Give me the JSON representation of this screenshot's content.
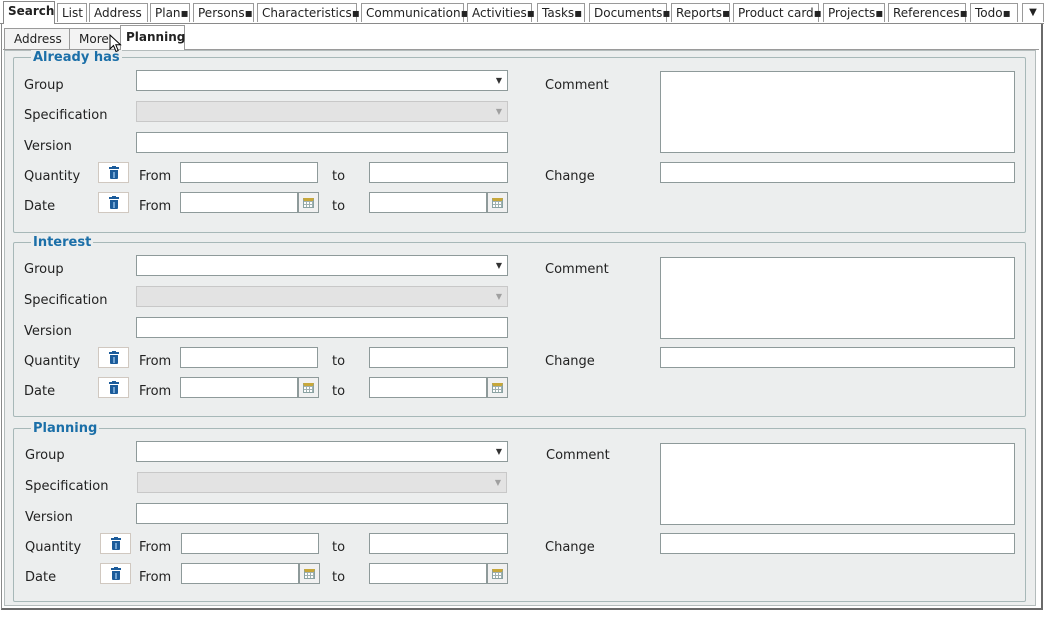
{
  "top_tabs": [
    {
      "label": "Search",
      "active": true
    },
    {
      "label": "List"
    },
    {
      "label": "Address"
    },
    {
      "label": "Plan▪"
    },
    {
      "label": "Persons▪"
    },
    {
      "label": "Characteristics▪"
    },
    {
      "label": "Communication▪"
    },
    {
      "label": "Activities▪"
    },
    {
      "label": "Tasks▪"
    },
    {
      "label": "Documents▪"
    },
    {
      "label": "Reports▪"
    },
    {
      "label": "Product card▪"
    },
    {
      "label": "Projects▪"
    },
    {
      "label": "References▪"
    },
    {
      "label": "Todo▪"
    }
  ],
  "top_tabs_more": "▼",
  "sub_tabs": [
    {
      "label": "Address"
    },
    {
      "label": "More"
    },
    {
      "label": "Planning",
      "active": true
    }
  ],
  "sections": [
    {
      "title": "Already has",
      "group_label": "Group",
      "group_value": "",
      "specification_label": "Specification",
      "specification_value": "",
      "version_label": "Version",
      "version_value": "",
      "quantity_label": "Quantity",
      "from_label": "From",
      "to_label": "to",
      "quantity_from": "",
      "quantity_to": "",
      "date_label": "Date",
      "date_from": "",
      "date_to": "",
      "comment_label": "Comment",
      "comment_value": "",
      "change_label": "Change",
      "change_value": ""
    },
    {
      "title": "Interest",
      "group_label": "Group",
      "group_value": "",
      "specification_label": "Specification",
      "specification_value": "",
      "version_label": "Version",
      "version_value": "",
      "quantity_label": "Quantity",
      "from_label": "From",
      "to_label": "to",
      "quantity_from": "",
      "quantity_to": "",
      "date_label": "Date",
      "date_from": "",
      "date_to": "",
      "comment_label": "Comment",
      "comment_value": "",
      "change_label": "Change",
      "change_value": ""
    },
    {
      "title": "Planning",
      "group_label": "Group",
      "group_value": "",
      "specification_label": "Specification",
      "specification_value": "",
      "version_label": "Version",
      "version_value": "",
      "quantity_label": "Quantity",
      "from_label": "From",
      "to_label": "to",
      "quantity_from": "",
      "quantity_to": "",
      "date_label": "Date",
      "date_from": "",
      "date_to": "",
      "comment_label": "Comment",
      "comment_value": "",
      "change_label": "Change",
      "change_value": ""
    }
  ],
  "colors": {
    "legend": "#1b6fa8",
    "panel_bg": "#eceeee",
    "trash_icon": "#1b5b9a"
  },
  "icons": {
    "trash": "trash-icon",
    "calendar": "calendar-icon",
    "dropdown": "chevron-down-icon",
    "cursor": "mouse-cursor-icon"
  }
}
